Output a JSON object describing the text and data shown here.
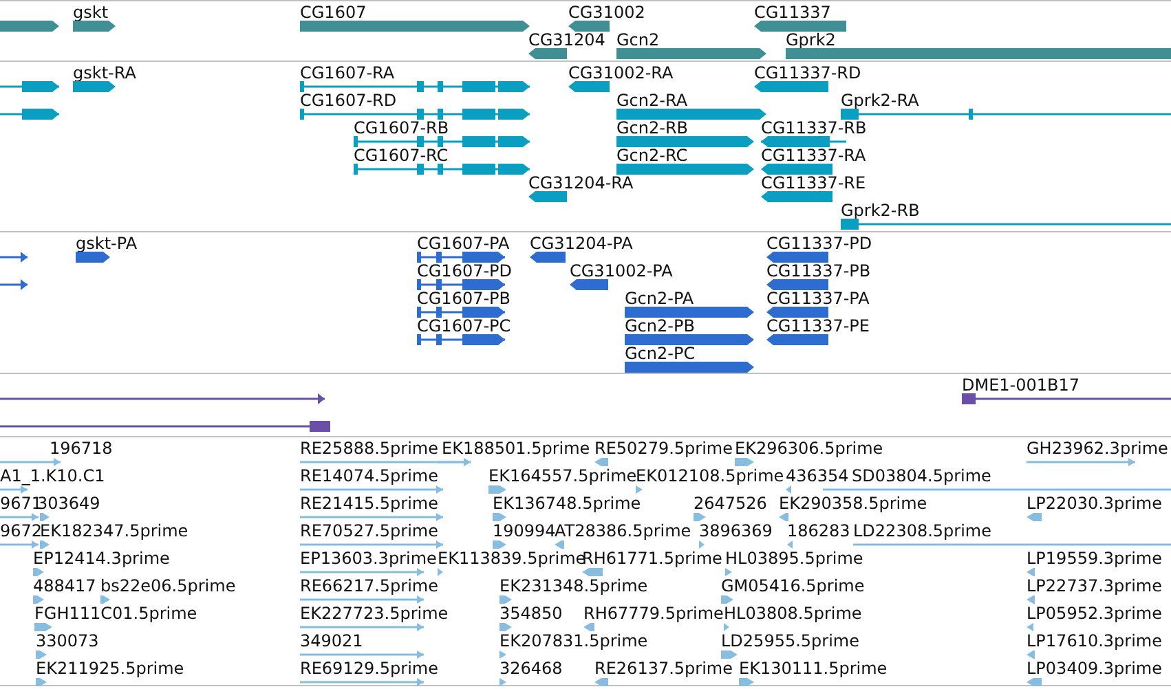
{
  "tracks": [
    {
      "kind": "gene",
      "color": "#408f94",
      "features": [
        {
          "reverse": false
        },
        {
          "label": "gskt",
          "reverse": false
        },
        {
          "label": "CG1607",
          "reverse": false
        },
        {
          "label": "CG31002",
          "reverse": true
        },
        {
          "label": "CG11337",
          "reverse": true
        },
        {
          "label": "CG31204",
          "reverse": true
        },
        {
          "label": "Gcn2",
          "reverse": false
        },
        {
          "label": "Gprk2",
          "reverse": false
        }
      ]
    },
    {
      "kind": "transcript",
      "color": "#0a9fc0",
      "features": [
        {
          "reverse": false
        },
        {
          "reverse": false
        },
        {
          "label": "gskt-RA",
          "reverse": false
        },
        {
          "label": "CG1607-RA",
          "reverse": false
        },
        {
          "label": "CG1607-RD",
          "reverse": false
        },
        {
          "label": "CG1607-RB",
          "reverse": false
        },
        {
          "label": "CG1607-RC",
          "reverse": false
        },
        {
          "label": "CG31002-RA",
          "reverse": true
        },
        {
          "label": "CG11337-RD",
          "reverse": true
        },
        {
          "label": "Gcn2-RA",
          "reverse": false
        },
        {
          "label": "Gprk2-RA",
          "reverse": false
        },
        {
          "label": "Gcn2-RB",
          "reverse": false
        },
        {
          "label": "CG11337-RB",
          "reverse": true
        },
        {
          "label": "Gcn2-RC",
          "reverse": false
        },
        {
          "label": "CG11337-RA",
          "reverse": true
        },
        {
          "label": "CG31204-RA",
          "reverse": true
        },
        {
          "label": "CG11337-RE",
          "reverse": true
        },
        {
          "label": "Gprk2-RB",
          "reverse": false
        }
      ]
    },
    {
      "kind": "protein",
      "color": "#2f6ccf",
      "features": [
        {
          "reverse": false
        },
        {
          "reverse": false
        },
        {
          "label": "gskt-PA",
          "reverse": false
        },
        {
          "label": "CG1607-PA",
          "reverse": false
        },
        {
          "label": "CG1607-PD",
          "reverse": false
        },
        {
          "label": "CG1607-PB",
          "reverse": false
        },
        {
          "label": "CG1607-PC",
          "reverse": false
        },
        {
          "label": "CG31204-PA",
          "reverse": true
        },
        {
          "label": "CG31002-PA",
          "reverse": true
        },
        {
          "label": "Gcn2-PA",
          "reverse": false
        },
        {
          "label": "Gcn2-PB",
          "reverse": false
        },
        {
          "label": "Gcn2-PC",
          "reverse": false
        },
        {
          "label": "CG11337-PD",
          "reverse": true
        },
        {
          "label": "CG11337-PB",
          "reverse": true
        },
        {
          "label": "CG11337-PA",
          "reverse": true
        },
        {
          "label": "CG11337-PE",
          "reverse": true
        }
      ]
    },
    {
      "kind": "clone",
      "color": "#6a4fa8",
      "features": [
        {
          "reverse": false
        },
        {
          "reverse": true
        },
        {
          "label": "DME1-001B17",
          "reverse": false
        }
      ]
    },
    {
      "kind": "est",
      "color": "#88bde0",
      "features": [
        {
          "label": "196718",
          "reverse": false
        },
        {
          "label": "RE25888.5prime",
          "reverse": false
        },
        {
          "label": "EK188501.5prime",
          "reverse": false
        },
        {
          "label": "RE50279.5prime",
          "reverse": true
        },
        {
          "label": "EK296306.5prime",
          "reverse": false
        },
        {
          "label": "GH23962.3prime",
          "reverse": false
        },
        {
          "label": "A1_1.K10.C1",
          "reverse": false
        },
        {
          "label": "RE14074.5prime",
          "reverse": false
        },
        {
          "label": "EK164557.5prime",
          "reverse": false
        },
        {
          "label": "EK012108.5prime",
          "reverse": false
        },
        {
          "label": "436354",
          "reverse": true
        },
        {
          "label": "SD03804.5prime",
          "reverse": false
        },
        {
          "label": "9671",
          "reverse": false
        },
        {
          "label": "303649",
          "reverse": false
        },
        {
          "label": "RE21415.5prime",
          "reverse": false
        },
        {
          "label": "EK136748.5prime",
          "reverse": false
        },
        {
          "label": "2647526",
          "reverse": false
        },
        {
          "label": "EK290358.5prime",
          "reverse": true
        },
        {
          "label": "LP22030.3prime",
          "reverse": true
        },
        {
          "label": "9672",
          "reverse": false
        },
        {
          "label": "EK182347.5prime",
          "reverse": false
        },
        {
          "label": "RE70527.5prime",
          "reverse": false
        },
        {
          "label": "190994",
          "reverse": false
        },
        {
          "label": "AT28386.5prime",
          "reverse": true
        },
        {
          "label": "3896369",
          "reverse": false
        },
        {
          "label": "186283",
          "reverse": true
        },
        {
          "label": "LD22308.5prime",
          "reverse": false
        },
        {
          "label": "EP12414.3prime",
          "reverse": false
        },
        {
          "label": "EP13603.3prime",
          "reverse": false
        },
        {
          "label": "EK113839.5prime",
          "reverse": false
        },
        {
          "label": "RH61771.5prime",
          "reverse": true
        },
        {
          "label": "HL03895.5prime",
          "reverse": false
        },
        {
          "label": "LP19559.3prime",
          "reverse": true
        },
        {
          "label": "488417",
          "reverse": false
        },
        {
          "label": "bs22e06.5prime",
          "reverse": false
        },
        {
          "label": "RE66217.5prime",
          "reverse": false
        },
        {
          "label": "EK231348.5prime",
          "reverse": false
        },
        {
          "label": "GM05416.5prime",
          "reverse": false
        },
        {
          "label": "LP22737.3prime",
          "reverse": true
        },
        {
          "label": "FGH111C01.5prime",
          "reverse": false
        },
        {
          "label": "EK227723.5prime",
          "reverse": false
        },
        {
          "label": "354850",
          "reverse": false
        },
        {
          "label": "RH67779.5prime",
          "reverse": true
        },
        {
          "label": "HL03808.5prime",
          "reverse": false
        },
        {
          "label": "LP05952.3prime",
          "reverse": true
        },
        {
          "label": "330073",
          "reverse": false
        },
        {
          "label": "349021",
          "reverse": false
        },
        {
          "label": "EK207831.5prime",
          "reverse": false
        },
        {
          "label": "LD25955.5prime",
          "reverse": false
        },
        {
          "label": "LP17610.3prime",
          "reverse": true
        },
        {
          "label": "EK211925.5prime",
          "reverse": false
        },
        {
          "label": "RE69129.5prime",
          "reverse": false
        },
        {
          "label": "326468",
          "reverse": false
        },
        {
          "label": "RE26137.5prime",
          "reverse": true
        },
        {
          "label": "EK130111.5prime",
          "reverse": false
        },
        {
          "label": "LP03409.3prime",
          "reverse": true
        }
      ]
    }
  ]
}
